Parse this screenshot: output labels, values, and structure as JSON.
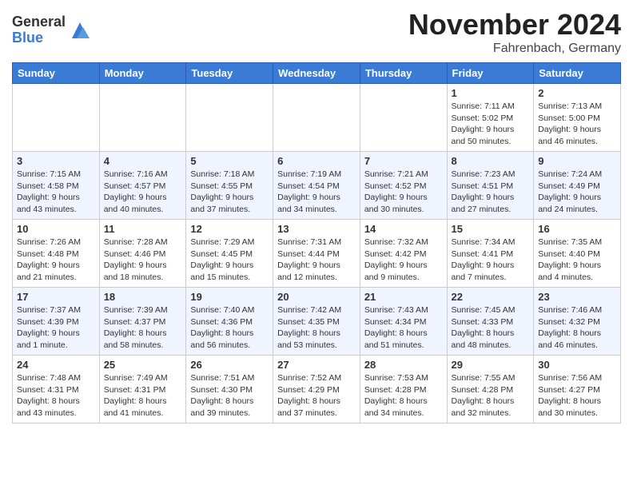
{
  "logo": {
    "general": "General",
    "blue": "Blue"
  },
  "header": {
    "month": "November 2024",
    "location": "Fahrenbach, Germany"
  },
  "days_of_week": [
    "Sunday",
    "Monday",
    "Tuesday",
    "Wednesday",
    "Thursday",
    "Friday",
    "Saturday"
  ],
  "weeks": [
    [
      {
        "day": "",
        "info": ""
      },
      {
        "day": "",
        "info": ""
      },
      {
        "day": "",
        "info": ""
      },
      {
        "day": "",
        "info": ""
      },
      {
        "day": "",
        "info": ""
      },
      {
        "day": "1",
        "info": "Sunrise: 7:11 AM\nSunset: 5:02 PM\nDaylight: 9 hours\nand 50 minutes."
      },
      {
        "day": "2",
        "info": "Sunrise: 7:13 AM\nSunset: 5:00 PM\nDaylight: 9 hours\nand 46 minutes."
      }
    ],
    [
      {
        "day": "3",
        "info": "Sunrise: 7:15 AM\nSunset: 4:58 PM\nDaylight: 9 hours\nand 43 minutes."
      },
      {
        "day": "4",
        "info": "Sunrise: 7:16 AM\nSunset: 4:57 PM\nDaylight: 9 hours\nand 40 minutes."
      },
      {
        "day": "5",
        "info": "Sunrise: 7:18 AM\nSunset: 4:55 PM\nDaylight: 9 hours\nand 37 minutes."
      },
      {
        "day": "6",
        "info": "Sunrise: 7:19 AM\nSunset: 4:54 PM\nDaylight: 9 hours\nand 34 minutes."
      },
      {
        "day": "7",
        "info": "Sunrise: 7:21 AM\nSunset: 4:52 PM\nDaylight: 9 hours\nand 30 minutes."
      },
      {
        "day": "8",
        "info": "Sunrise: 7:23 AM\nSunset: 4:51 PM\nDaylight: 9 hours\nand 27 minutes."
      },
      {
        "day": "9",
        "info": "Sunrise: 7:24 AM\nSunset: 4:49 PM\nDaylight: 9 hours\nand 24 minutes."
      }
    ],
    [
      {
        "day": "10",
        "info": "Sunrise: 7:26 AM\nSunset: 4:48 PM\nDaylight: 9 hours\nand 21 minutes."
      },
      {
        "day": "11",
        "info": "Sunrise: 7:28 AM\nSunset: 4:46 PM\nDaylight: 9 hours\nand 18 minutes."
      },
      {
        "day": "12",
        "info": "Sunrise: 7:29 AM\nSunset: 4:45 PM\nDaylight: 9 hours\nand 15 minutes."
      },
      {
        "day": "13",
        "info": "Sunrise: 7:31 AM\nSunset: 4:44 PM\nDaylight: 9 hours\nand 12 minutes."
      },
      {
        "day": "14",
        "info": "Sunrise: 7:32 AM\nSunset: 4:42 PM\nDaylight: 9 hours\nand 9 minutes."
      },
      {
        "day": "15",
        "info": "Sunrise: 7:34 AM\nSunset: 4:41 PM\nDaylight: 9 hours\nand 7 minutes."
      },
      {
        "day": "16",
        "info": "Sunrise: 7:35 AM\nSunset: 4:40 PM\nDaylight: 9 hours\nand 4 minutes."
      }
    ],
    [
      {
        "day": "17",
        "info": "Sunrise: 7:37 AM\nSunset: 4:39 PM\nDaylight: 9 hours\nand 1 minute."
      },
      {
        "day": "18",
        "info": "Sunrise: 7:39 AM\nSunset: 4:37 PM\nDaylight: 8 hours\nand 58 minutes."
      },
      {
        "day": "19",
        "info": "Sunrise: 7:40 AM\nSunset: 4:36 PM\nDaylight: 8 hours\nand 56 minutes."
      },
      {
        "day": "20",
        "info": "Sunrise: 7:42 AM\nSunset: 4:35 PM\nDaylight: 8 hours\nand 53 minutes."
      },
      {
        "day": "21",
        "info": "Sunrise: 7:43 AM\nSunset: 4:34 PM\nDaylight: 8 hours\nand 51 minutes."
      },
      {
        "day": "22",
        "info": "Sunrise: 7:45 AM\nSunset: 4:33 PM\nDaylight: 8 hours\nand 48 minutes."
      },
      {
        "day": "23",
        "info": "Sunrise: 7:46 AM\nSunset: 4:32 PM\nDaylight: 8 hours\nand 46 minutes."
      }
    ],
    [
      {
        "day": "24",
        "info": "Sunrise: 7:48 AM\nSunset: 4:31 PM\nDaylight: 8 hours\nand 43 minutes."
      },
      {
        "day": "25",
        "info": "Sunrise: 7:49 AM\nSunset: 4:31 PM\nDaylight: 8 hours\nand 41 minutes."
      },
      {
        "day": "26",
        "info": "Sunrise: 7:51 AM\nSunset: 4:30 PM\nDaylight: 8 hours\nand 39 minutes."
      },
      {
        "day": "27",
        "info": "Sunrise: 7:52 AM\nSunset: 4:29 PM\nDaylight: 8 hours\nand 37 minutes."
      },
      {
        "day": "28",
        "info": "Sunrise: 7:53 AM\nSunset: 4:28 PM\nDaylight: 8 hours\nand 34 minutes."
      },
      {
        "day": "29",
        "info": "Sunrise: 7:55 AM\nSunset: 4:28 PM\nDaylight: 8 hours\nand 32 minutes."
      },
      {
        "day": "30",
        "info": "Sunrise: 7:56 AM\nSunset: 4:27 PM\nDaylight: 8 hours\nand 30 minutes."
      }
    ]
  ]
}
